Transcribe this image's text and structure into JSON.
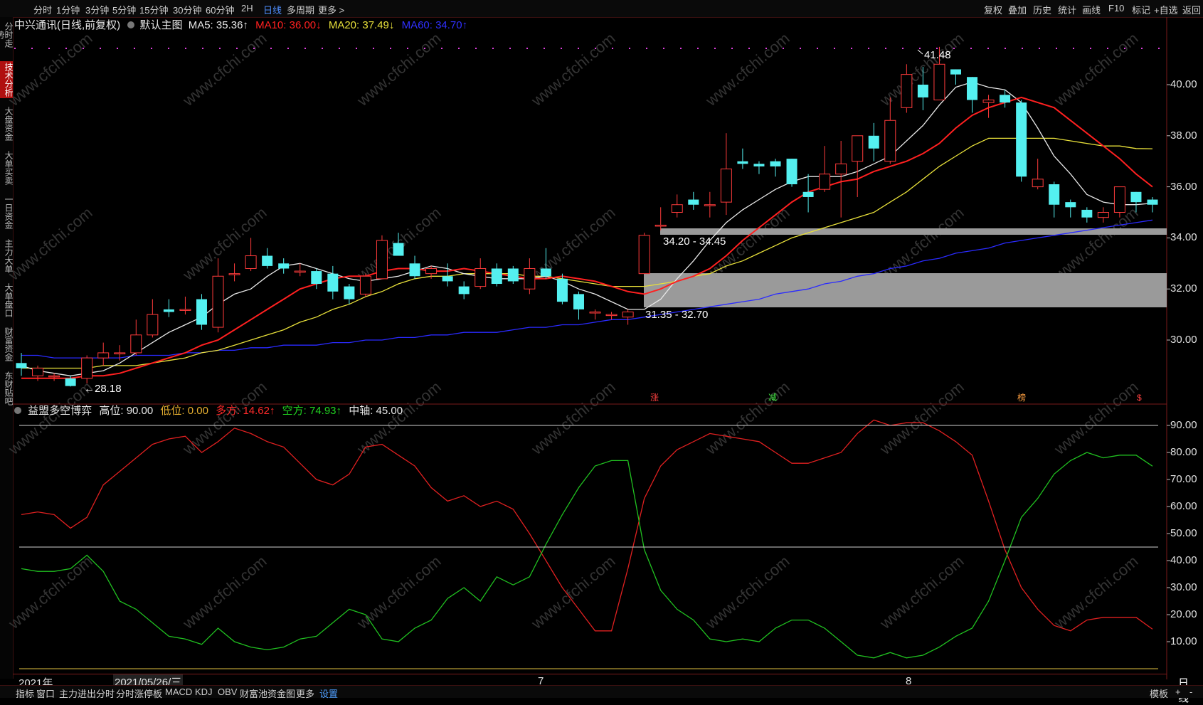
{
  "topbar": {
    "tabs": [
      "分时",
      "1分钟",
      "3分钟",
      "5分钟",
      "15分钟",
      "30分钟",
      "60分钟",
      "2H",
      "日线",
      "多周期",
      "更多 >"
    ],
    "selected": "日线",
    "right_tools": [
      "复权",
      "叠加",
      "历史",
      "统计",
      "画线",
      "F10",
      "标记",
      "+自选",
      "返回"
    ]
  },
  "leftnav": [
    "分时走势",
    "技术分析",
    "大盘资金",
    "大单买卖",
    "一日资金",
    "主力大单",
    "大单盘口",
    "财富资金",
    "东财贴吧"
  ],
  "main_info": {
    "stock": "中兴通讯(日线,前复权)",
    "template": "默认主图",
    "ma5": "MA5: 35.36↑",
    "ma10": "MA10: 36.00↓",
    "ma20": "MA20: 37.49↓",
    "ma60": "MA60: 34.70↑"
  },
  "sub_info": {
    "name": "益盟多空博弈",
    "high": "高位: 90.00",
    "low": "低位: 0.00",
    "long": "多方: 14.62↑",
    "short": "空方: 74.93↑",
    "mid": "中轴: 45.00"
  },
  "price_axis": [
    "40.00",
    "38.00",
    "36.00",
    "34.00",
    "32.00",
    "30.00"
  ],
  "indicator_axis": [
    "90.00",
    "80.00",
    "70.00",
    "60.00",
    "50.00",
    "40.00",
    "30.00",
    "20.00",
    "10.00"
  ],
  "annotations": {
    "high": "41.48",
    "low": "←28.18",
    "zone_upper": "34.20 - 34.45",
    "zone_lower": "31.35 - 32.70",
    "markers": [
      "涨",
      "减",
      "榜",
      "$"
    ]
  },
  "date_axis": {
    "year": "2021年",
    "cursor": "2021/05/26/三",
    "months": [
      "7",
      "8"
    ],
    "period": "日线"
  },
  "bottombar": [
    "指标",
    "窗口",
    "主力进出分时",
    "分时涨停板",
    "MACD",
    "KDJ",
    "OBV",
    "财富池资金图",
    "更多",
    "设置"
  ],
  "bottom_right": [
    "模板",
    "+",
    "-"
  ],
  "watermark": "www.cfchi.com",
  "colors": {
    "up": "#ff3b3b",
    "down": "#54f0f0",
    "ma5": "#e8e8e8",
    "ma10": "#ff2020",
    "ma20": "#e8e03a",
    "ma60": "#2a2aff",
    "long": "#e02020",
    "short": "#20c020"
  },
  "chart_data": [
    {
      "type": "candlestick",
      "title": "中兴通讯(日线,前复权)",
      "ylim": [
        28,
        42
      ],
      "candles": [
        [
          29.1,
          28.9,
          29.5,
          28.6
        ],
        [
          28.6,
          28.9,
          29.0,
          28.4
        ],
        [
          28.6,
          28.6,
          28.7,
          28.4
        ],
        [
          28.5,
          28.2,
          28.6,
          28.18
        ],
        [
          28.5,
          29.3,
          29.4,
          28.3
        ],
        [
          29.3,
          29.5,
          29.9,
          29.0
        ],
        [
          29.5,
          29.5,
          29.8,
          29.2
        ],
        [
          29.5,
          30.2,
          30.8,
          29.4
        ],
        [
          30.2,
          31.0,
          31.6,
          30.1
        ],
        [
          31.2,
          31.1,
          31.6,
          30.9
        ],
        [
          31.2,
          31.2,
          31.7,
          31.0
        ],
        [
          31.6,
          30.6,
          31.8,
          30.4
        ],
        [
          30.5,
          32.5,
          33.2,
          30.3
        ],
        [
          32.6,
          32.6,
          33.0,
          32.3
        ],
        [
          32.8,
          33.3,
          34.0,
          32.7
        ],
        [
          33.3,
          32.9,
          33.6,
          32.8
        ],
        [
          33.0,
          32.8,
          33.2,
          32.6
        ],
        [
          32.7,
          32.7,
          33.0,
          32.5
        ],
        [
          32.7,
          32.2,
          32.8,
          32.0
        ],
        [
          32.6,
          31.9,
          32.9,
          31.6
        ],
        [
          32.1,
          31.6,
          32.2,
          31.4
        ],
        [
          31.8,
          32.5,
          32.6,
          31.7
        ],
        [
          32.4,
          33.9,
          34.1,
          32.4
        ],
        [
          33.8,
          33.3,
          34.2,
          33.3
        ],
        [
          33.0,
          32.5,
          33.3,
          32.4
        ],
        [
          32.6,
          32.8,
          32.9,
          32.4
        ],
        [
          32.5,
          32.3,
          33.0,
          32.1
        ],
        [
          32.1,
          31.8,
          32.3,
          31.6
        ],
        [
          32.1,
          32.8,
          33.2,
          32.0
        ],
        [
          32.8,
          32.2,
          33.0,
          32.1
        ],
        [
          32.8,
          32.3,
          32.9,
          32.2
        ],
        [
          32.0,
          32.8,
          33.2,
          31.8
        ],
        [
          32.8,
          32.5,
          33.6,
          32.4
        ],
        [
          32.4,
          31.5,
          32.6,
          31.4
        ],
        [
          31.8,
          31.2,
          31.9,
          30.8
        ],
        [
          31.1,
          31.1,
          31.2,
          30.8
        ],
        [
          31.0,
          31.0,
          31.1,
          30.8
        ],
        [
          30.9,
          31.1,
          31.2,
          30.6
        ],
        [
          32.6,
          34.1,
          34.2,
          32.6
        ],
        [
          34.5,
          34.5,
          35.2,
          34.3
        ],
        [
          35.0,
          35.3,
          35.7,
          34.8
        ],
        [
          35.5,
          35.3,
          35.8,
          35.1
        ],
        [
          35.3,
          35.3,
          35.8,
          34.8
        ],
        [
          35.4,
          36.7,
          38.1,
          34.9
        ],
        [
          37.0,
          36.9,
          37.5,
          36.7
        ],
        [
          36.9,
          36.8,
          37.0,
          36.5
        ],
        [
          37.0,
          36.8,
          37.1,
          36.4
        ],
        [
          37.1,
          36.1,
          37.1,
          36.0
        ],
        [
          35.8,
          35.6,
          36.5,
          35.0
        ],
        [
          35.9,
          36.5,
          37.6,
          35.8
        ],
        [
          36.5,
          36.9,
          37.8,
          34.8
        ],
        [
          37.0,
          38.0,
          38.0,
          35.6
        ],
        [
          38.0,
          37.5,
          38.5,
          37.0
        ],
        [
          37.0,
          38.6,
          39.5,
          36.9
        ],
        [
          39.1,
          40.4,
          40.8,
          38.9
        ],
        [
          40.0,
          39.5,
          40.7,
          39.0
        ],
        [
          39.4,
          40.8,
          41.48,
          39.4
        ],
        [
          40.6,
          40.4,
          40.6,
          40.0
        ],
        [
          40.3,
          39.4,
          40.3,
          38.9
        ],
        [
          39.3,
          39.4,
          39.6,
          38.7
        ],
        [
          39.6,
          39.3,
          39.8,
          39.1
        ],
        [
          39.3,
          36.4,
          39.4,
          36.2
        ],
        [
          36.0,
          36.3,
          37.1,
          35.9
        ],
        [
          36.1,
          35.3,
          36.2,
          34.8
        ],
        [
          35.4,
          35.2,
          35.5,
          34.8
        ],
        [
          35.1,
          34.8,
          35.2,
          34.6
        ],
        [
          34.8,
          35.0,
          35.2,
          34.6
        ],
        [
          35.0,
          36.0,
          36.0,
          34.8
        ],
        [
          35.8,
          35.4,
          35.8,
          35.0
        ],
        [
          35.5,
          35.3,
          35.6,
          35.0
        ]
      ],
      "ma5": [
        29.0,
        28.8,
        28.7,
        28.6,
        28.7,
        28.8,
        29.1,
        29.5,
        29.9,
        30.3,
        30.6,
        30.9,
        31.4,
        31.8,
        32.0,
        32.5,
        32.9,
        33.0,
        32.8,
        32.6,
        32.4,
        32.3,
        32.4,
        32.5,
        32.7,
        32.9,
        32.8,
        32.6,
        32.5,
        32.4,
        32.4,
        32.4,
        32.5,
        32.3,
        32.0,
        31.8,
        31.5,
        31.2,
        31.2,
        31.6,
        32.4,
        33.1,
        33.9,
        34.6,
        35.1,
        35.5,
        35.9,
        36.2,
        36.4,
        36.4,
        36.4,
        36.6,
        36.9,
        37.2,
        37.8,
        38.4,
        39.2,
        39.9,
        40.1,
        39.9,
        39.8,
        39.3,
        38.3,
        37.2,
        36.5,
        35.7,
        35.4,
        35.3,
        35.3,
        35.36
      ],
      "ma10": [
        28.5,
        28.5,
        28.5,
        28.5,
        28.6,
        28.6,
        28.7,
        28.9,
        29.1,
        29.3,
        29.5,
        29.8,
        30.0,
        30.4,
        30.8,
        31.2,
        31.6,
        32.0,
        32.2,
        32.4,
        32.5,
        32.5,
        32.7,
        32.8,
        32.8,
        32.7,
        32.7,
        32.8,
        32.7,
        32.6,
        32.5,
        32.4,
        32.4,
        32.5,
        32.4,
        32.3,
        32.1,
        31.9,
        31.8,
        32.0,
        32.3,
        32.5,
        32.8,
        33.3,
        33.9,
        34.4,
        34.9,
        35.4,
        35.8,
        36.0,
        36.2,
        36.3,
        36.6,
        36.8,
        37.0,
        37.3,
        37.7,
        38.3,
        38.8,
        39.1,
        39.3,
        39.5,
        39.3,
        39.1,
        38.6,
        38.1,
        37.6,
        37.1,
        36.5,
        36.0
      ],
      "ma20": [
        28.9,
        28.9,
        28.9,
        28.9,
        28.9,
        29.0,
        29.0,
        29.0,
        29.1,
        29.2,
        29.3,
        29.5,
        29.6,
        29.8,
        30.0,
        30.2,
        30.4,
        30.7,
        30.9,
        31.2,
        31.4,
        31.7,
        31.9,
        32.2,
        32.4,
        32.5,
        32.5,
        32.6,
        32.6,
        32.6,
        32.6,
        32.5,
        32.5,
        32.4,
        32.3,
        32.2,
        32.1,
        32.1,
        32.1,
        32.2,
        32.3,
        32.5,
        32.6,
        32.9,
        33.1,
        33.4,
        33.7,
        34.0,
        34.2,
        34.4,
        34.6,
        34.8,
        35.0,
        35.4,
        35.8,
        36.3,
        36.8,
        37.2,
        37.6,
        37.9,
        37.9,
        37.9,
        37.9,
        37.9,
        37.8,
        37.7,
        37.6,
        37.6,
        37.5,
        37.49
      ],
      "ma60": [
        29.4,
        29.4,
        29.3,
        29.3,
        29.3,
        29.3,
        29.3,
        29.4,
        29.4,
        29.4,
        29.5,
        29.5,
        29.6,
        29.6,
        29.7,
        29.7,
        29.8,
        29.8,
        29.8,
        29.9,
        29.9,
        30.0,
        30.0,
        30.1,
        30.1,
        30.2,
        30.2,
        30.3,
        30.3,
        30.3,
        30.4,
        30.5,
        30.5,
        30.6,
        30.6,
        30.7,
        30.8,
        30.8,
        30.9,
        31.0,
        31.1,
        31.2,
        31.3,
        31.4,
        31.5,
        31.6,
        31.8,
        31.9,
        32.0,
        32.2,
        32.3,
        32.5,
        32.6,
        32.8,
        32.9,
        33.1,
        33.2,
        33.4,
        33.5,
        33.6,
        33.8,
        33.9,
        34.0,
        34.1,
        34.2,
        34.3,
        34.4,
        34.5,
        34.6,
        34.7
      ]
    },
    {
      "type": "line",
      "title": "益盟多空博弈",
      "ylim": [
        0,
        95
      ],
      "series": [
        {
          "name": "多方",
          "values": [
            57,
            58,
            57,
            52,
            56,
            68,
            73,
            78,
            83,
            85,
            86,
            80,
            84,
            89,
            87,
            84,
            82,
            76,
            70,
            68,
            72,
            82,
            83,
            79,
            75,
            67,
            62,
            64,
            60,
            62,
            59,
            50,
            40,
            30,
            22,
            14,
            14,
            37,
            63,
            75,
            81,
            84,
            87,
            86,
            85,
            84,
            80,
            76,
            76,
            78,
            80,
            87,
            92,
            90,
            91,
            91,
            88,
            84,
            79,
            62,
            44,
            30,
            22,
            16,
            14,
            18,
            19,
            19,
            19,
            14.62
          ]
        },
        {
          "name": "空方",
          "values": [
            37,
            36,
            36,
            37,
            42,
            36,
            25,
            22,
            17,
            12,
            11,
            9,
            15,
            10,
            8,
            7,
            8,
            11,
            12,
            17,
            22,
            20,
            11,
            10,
            15,
            18,
            26,
            30,
            25,
            34,
            31,
            34,
            46,
            57,
            67,
            75,
            77,
            77,
            44,
            29,
            22,
            18,
            11,
            10,
            11,
            10,
            15,
            18,
            18,
            15,
            10,
            5,
            4,
            6,
            4,
            5,
            8,
            12,
            15,
            25,
            40,
            56,
            63,
            72,
            77,
            80,
            78,
            79,
            79,
            74.93
          ]
        }
      ]
    }
  ]
}
